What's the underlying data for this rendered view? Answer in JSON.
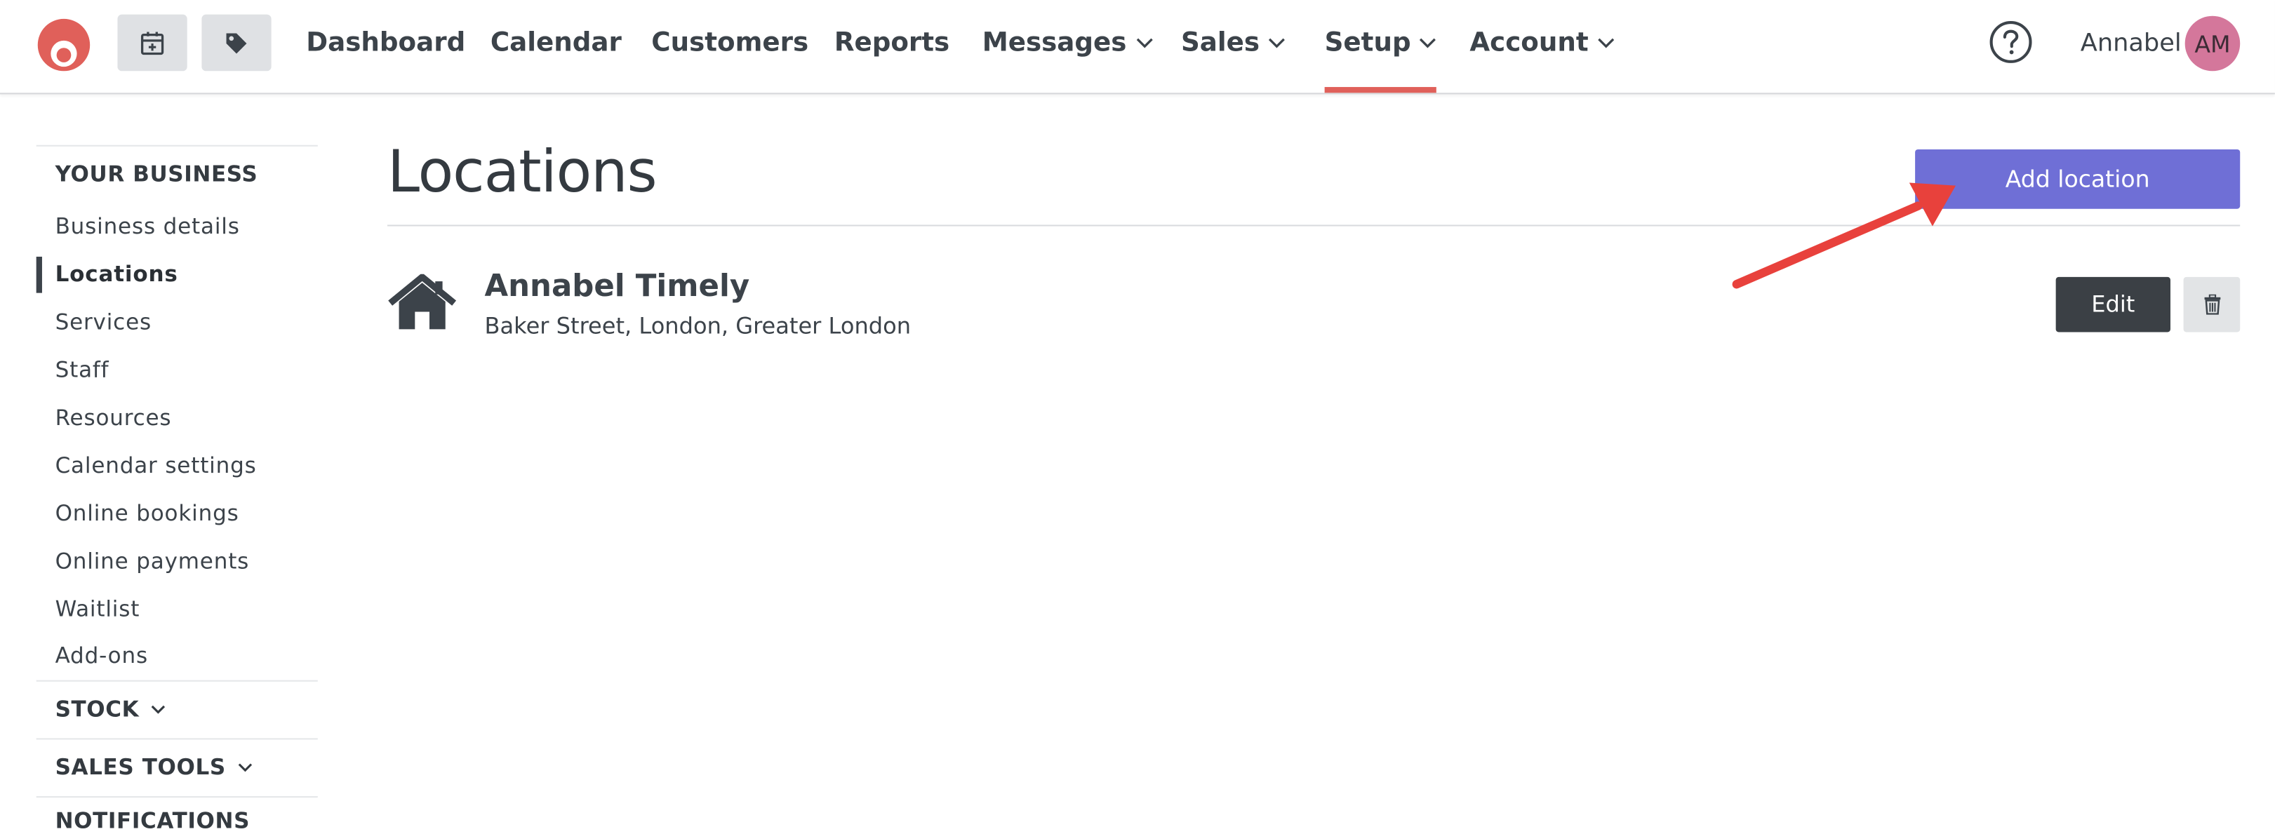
{
  "nav": {
    "links": [
      "Dashboard",
      "Calendar",
      "Customers",
      "Reports",
      "Messages",
      "Sales",
      "Setup",
      "Account"
    ],
    "active": "Setup",
    "user_name": "Annabel",
    "avatar_initials": "AM",
    "brand_color": "#e0605a"
  },
  "sidebar": {
    "section_your_business": "YOUR BUSINESS",
    "items": [
      {
        "label": "Business details"
      },
      {
        "label": "Locations"
      },
      {
        "label": "Services"
      },
      {
        "label": "Staff"
      },
      {
        "label": "Resources"
      },
      {
        "label": "Calendar settings"
      },
      {
        "label": "Online bookings"
      },
      {
        "label": "Online payments"
      },
      {
        "label": "Waitlist"
      },
      {
        "label": "Add-ons"
      }
    ],
    "active_item": "Locations",
    "section_stock": "STOCK",
    "section_sales_tools": "SALES TOOLS",
    "section_notifications": "NOTIFICATIONS"
  },
  "main": {
    "title": "Locations",
    "add_button": "Add location",
    "add_button_color": "#6f6fd6",
    "location": {
      "name": "Annabel Timely",
      "address": "Baker Street, London, Greater London",
      "edit_button": "Edit"
    }
  },
  "annotation": {
    "arrow_color": "#e8413c"
  }
}
